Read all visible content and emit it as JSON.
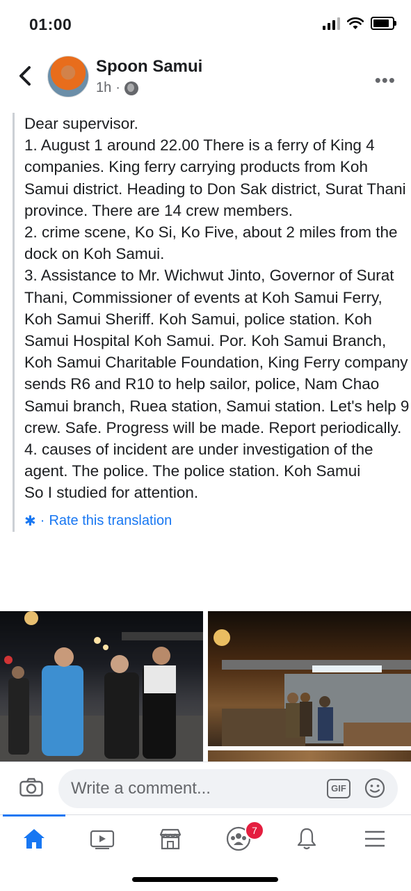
{
  "status": {
    "time": "01:00"
  },
  "header": {
    "author": "Spoon Samui",
    "time_ago": "1h",
    "separator": "·"
  },
  "post": {
    "lines": [
      "Dear supervisor.",
      "1. August 1 around 22.00 There is a ferry of King 4 companies. King ferry carrying products from Koh Samui district. Heading to Don Sak district, Surat Thani province. There are 14 crew members.",
      "2. crime scene, Ko Si, Ko Five, about 2 miles from the dock on Koh Samui.",
      "3. Assistance to Mr. Wichwut Jinto, Governor of Surat Thani, Commissioner of events at Koh Samui Ferry, Koh Samui Sheriff. Koh Samui, police station. Koh Samui Hospital Koh Samui. Por. Koh Samui Branch, Koh Samui Charitable Foundation, King Ferry company sends R6 and R10 to help sailor, police, Nam Chao Samui branch, Ruea station, Samui station. Let's help 9 crew. Safe. Progress will be made. Report periodically.",
      "4. causes of incident are under investigation of the agent. The police. The police station. Koh Samui",
      "So I studied for attention."
    ],
    "rate_translation": "Rate this translation",
    "rate_separator": "·"
  },
  "comment": {
    "placeholder": "Write a comment...",
    "gif_label": "GIF"
  },
  "tabs": {
    "groups_badge": "7"
  },
  "colors": {
    "accent": "#1877f2",
    "badge": "#e41e3f",
    "muted": "#65676b"
  }
}
